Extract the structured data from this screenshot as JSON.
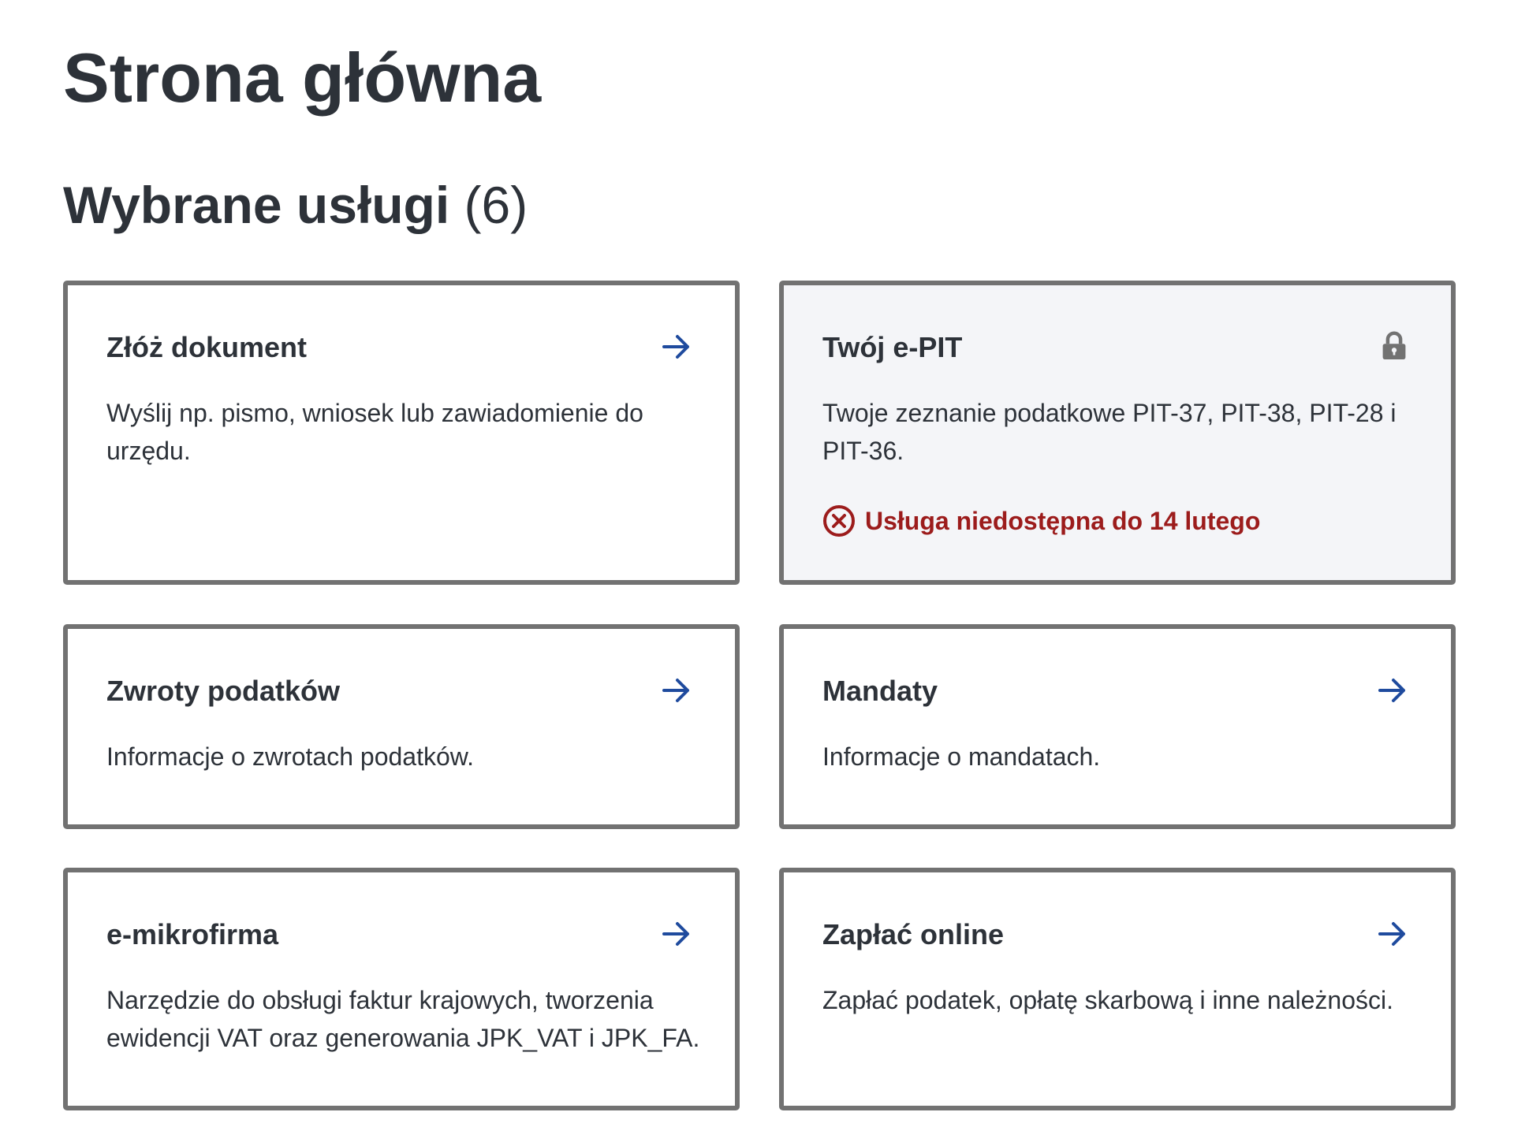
{
  "page": {
    "title": "Strona główna"
  },
  "section": {
    "title": "Wybrane usługi",
    "count": "(6)"
  },
  "colors": {
    "accent": "#1f4b9e",
    "error": "#9c1c1c",
    "text": "#2d3239",
    "border": "#727272",
    "disabled_bg": "#f4f5f8"
  },
  "cards": [
    {
      "title": "Złóż dokument",
      "description": "Wyślij np. pismo, wniosek lub zawiadomienie do urzędu.",
      "icon": "arrow-right-icon"
    },
    {
      "title": "Twój e-PIT",
      "description": "Twoje zeznanie podatkowe PIT-37, PIT-38, PIT-28 i PIT-36.",
      "icon": "lock-icon",
      "status": "Usługa niedostępna do 14 lutego"
    },
    {
      "title": "Zwroty podatków",
      "description": "Informacje o zwrotach podatków.",
      "icon": "arrow-right-icon"
    },
    {
      "title": "Mandaty",
      "description": "Informacje o mandatach.",
      "icon": "arrow-right-icon"
    },
    {
      "title": "e-mikrofirma",
      "description": "Narzędzie do obsługi faktur krajowych, tworzenia ewidencji VAT oraz generowania JPK_VAT i JPK_FA.",
      "icon": "arrow-right-icon"
    },
    {
      "title": "Zapłać online",
      "description": "Zapłać podatek, opłatę skarbową i inne należności.",
      "icon": "arrow-right-icon"
    }
  ]
}
